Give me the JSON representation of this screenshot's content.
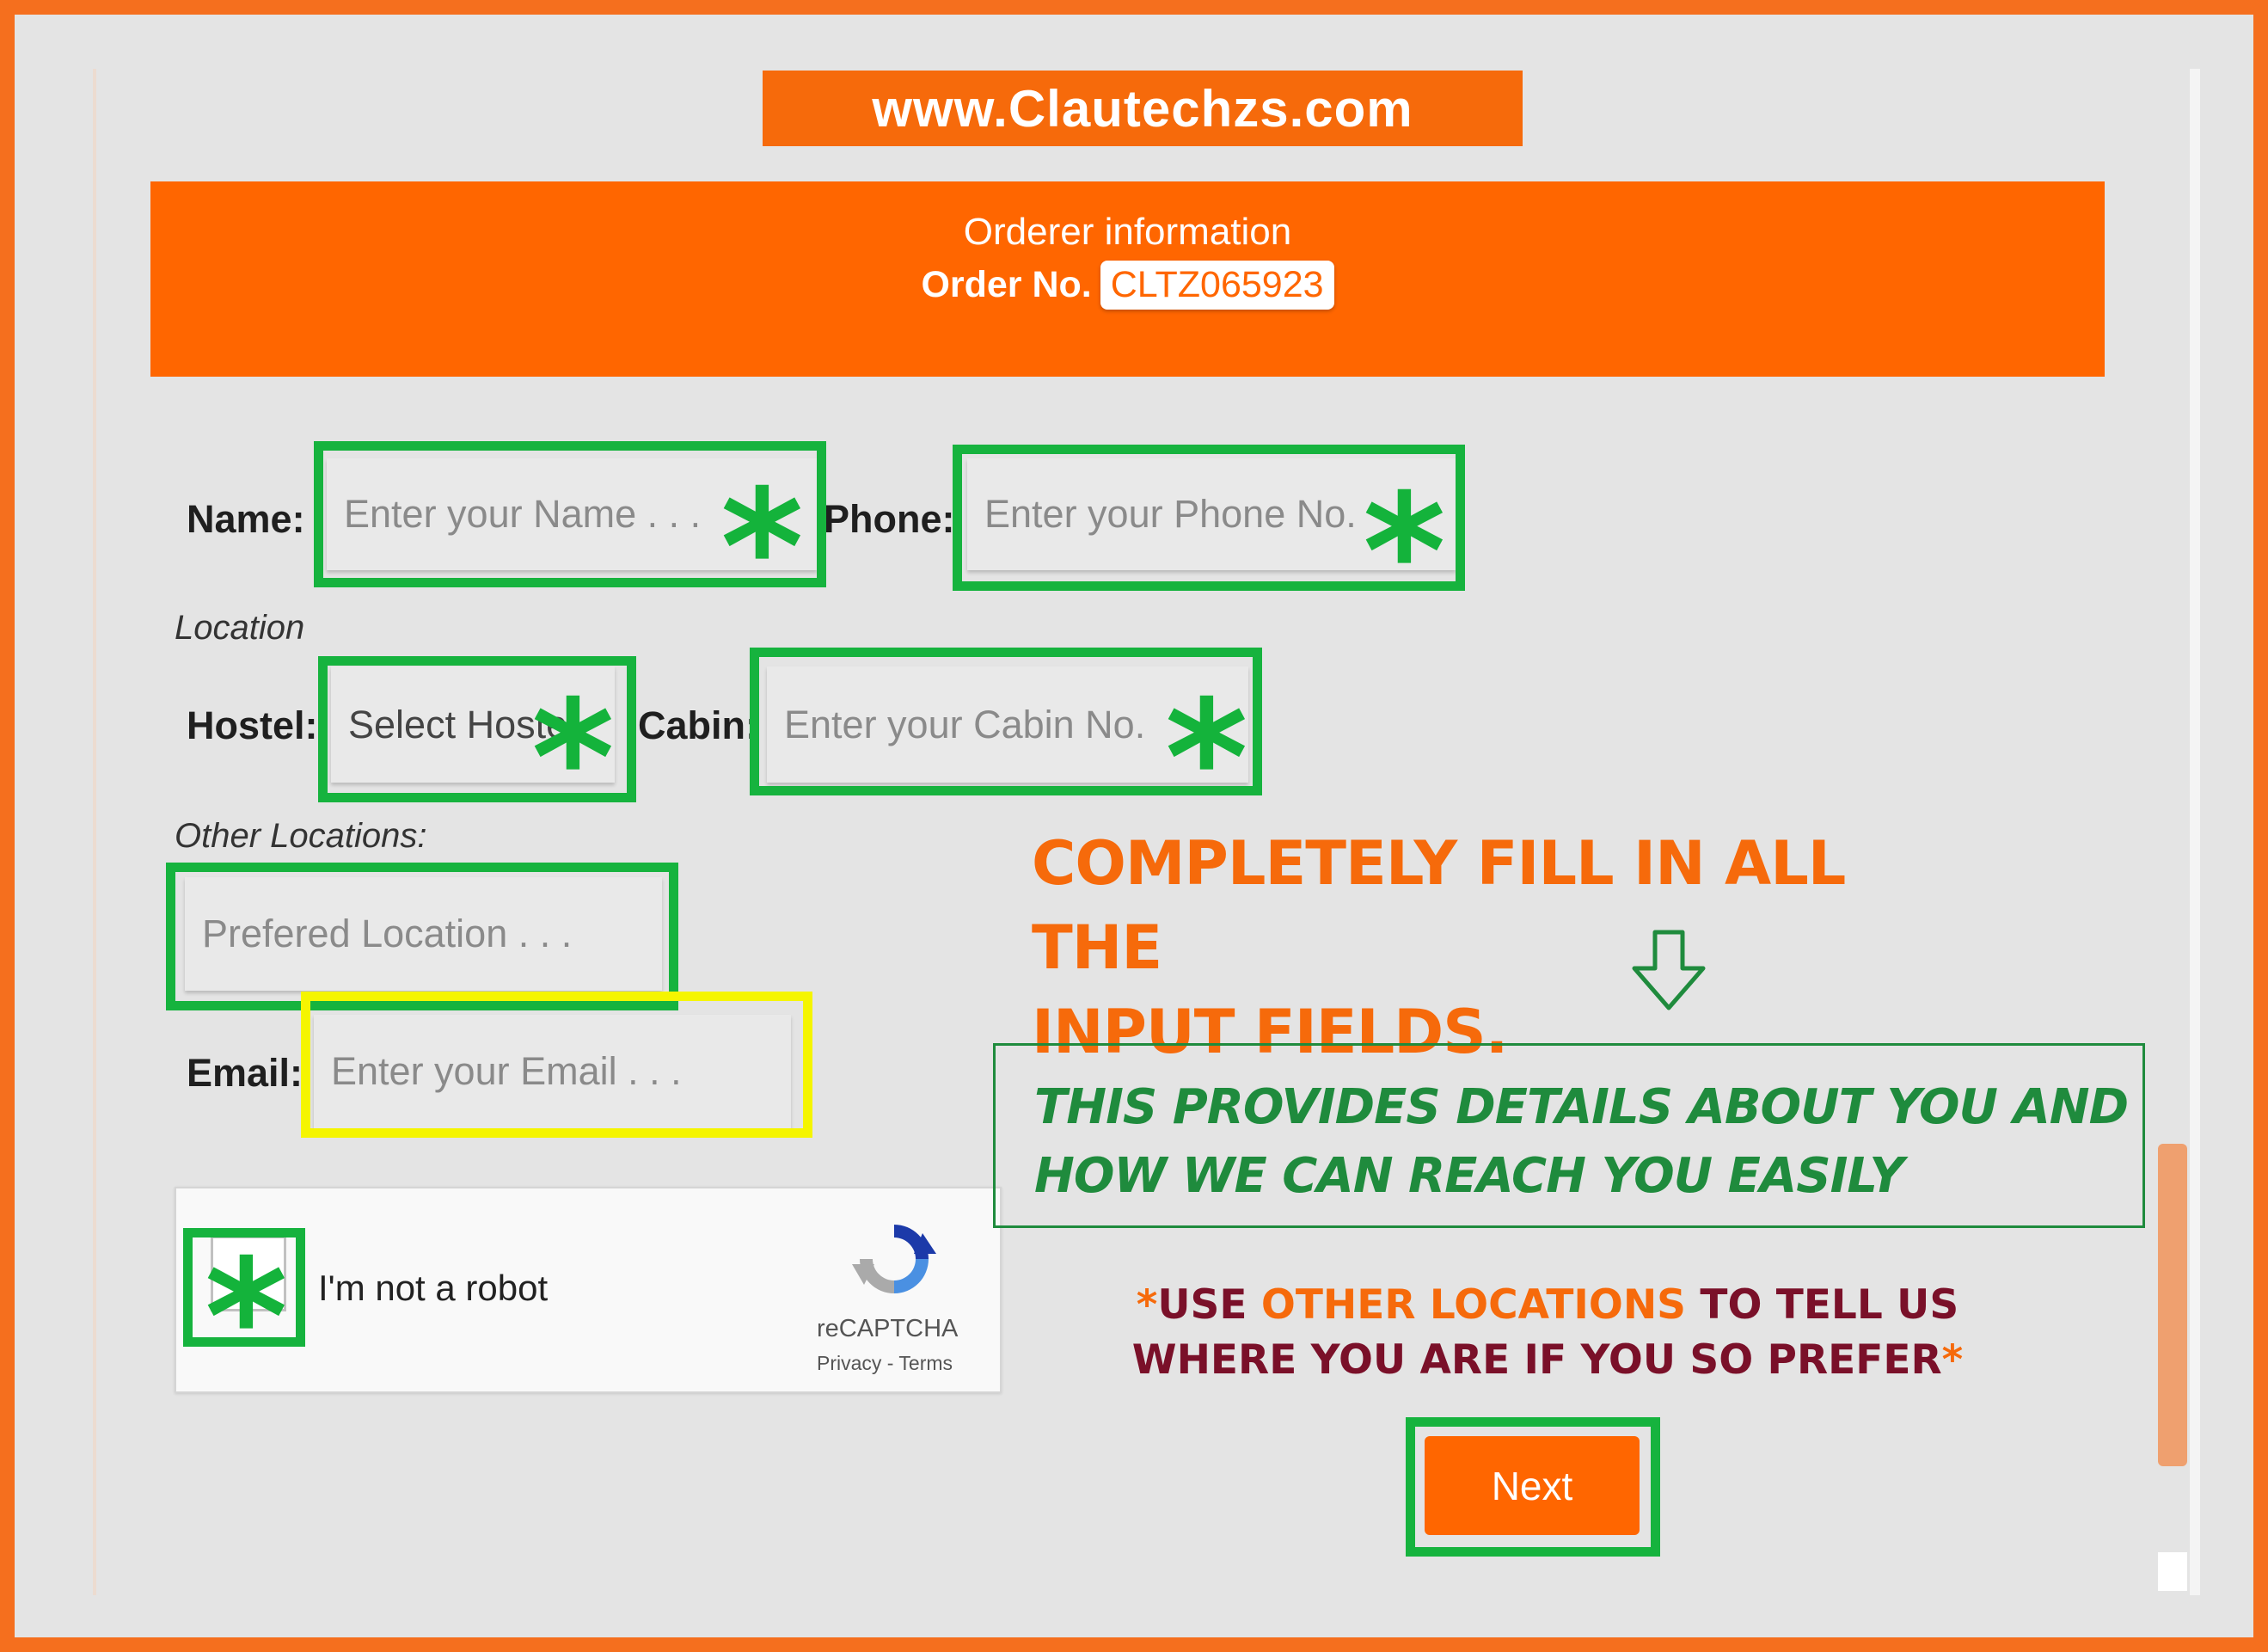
{
  "banner": {
    "text": "www.Clautechzs.com"
  },
  "header": {
    "title": "Orderer information",
    "order_label": "Order No.",
    "order_number": "CLTZ065923"
  },
  "form": {
    "name_label": "Name:",
    "name_placeholder": "Enter your Name . . .",
    "phone_label": "Phone:",
    "phone_placeholder": "Enter your Phone No.",
    "location_heading": "Location",
    "hostel_label": "Hostel:",
    "hostel_selected": "Select Hostel",
    "cabin_label": "Cabin:",
    "cabin_placeholder": "Enter your Cabin No.",
    "other_locations_heading": "Other Locations:",
    "preferred_placeholder": "Prefered Location . . .",
    "email_label": "Email:",
    "email_placeholder": "Enter your Email . . ."
  },
  "captcha": {
    "label": "I'm not a robot",
    "brand": "reCAPTCHA",
    "links": "Privacy - Terms"
  },
  "annotations": {
    "star": "*",
    "instruction_line1": "COMPLETELY FILL IN ALL THE",
    "instruction_line2": "INPUT FIELDS.",
    "info_line1": "THIS PROVIDES DETAILS ABOUT YOU AND",
    "info_line2": "HOW WE CAN REACH YOU EASILY",
    "note_star": "*",
    "note_use": "USE ",
    "note_other_locations": "OTHER LOCATIONS",
    "note_rest1": " TO TELL US",
    "note_line2": "WHERE YOU ARE IF YOU SO PREFER",
    "note_end_star": "*"
  },
  "next_button": {
    "label": "Next"
  },
  "colors": {
    "brand_orange": "#ff6600",
    "highlight_green": "#16b33e",
    "highlight_yellow": "#f5f500",
    "note_green": "#1f8b3d",
    "note_red": "#7a1029"
  }
}
